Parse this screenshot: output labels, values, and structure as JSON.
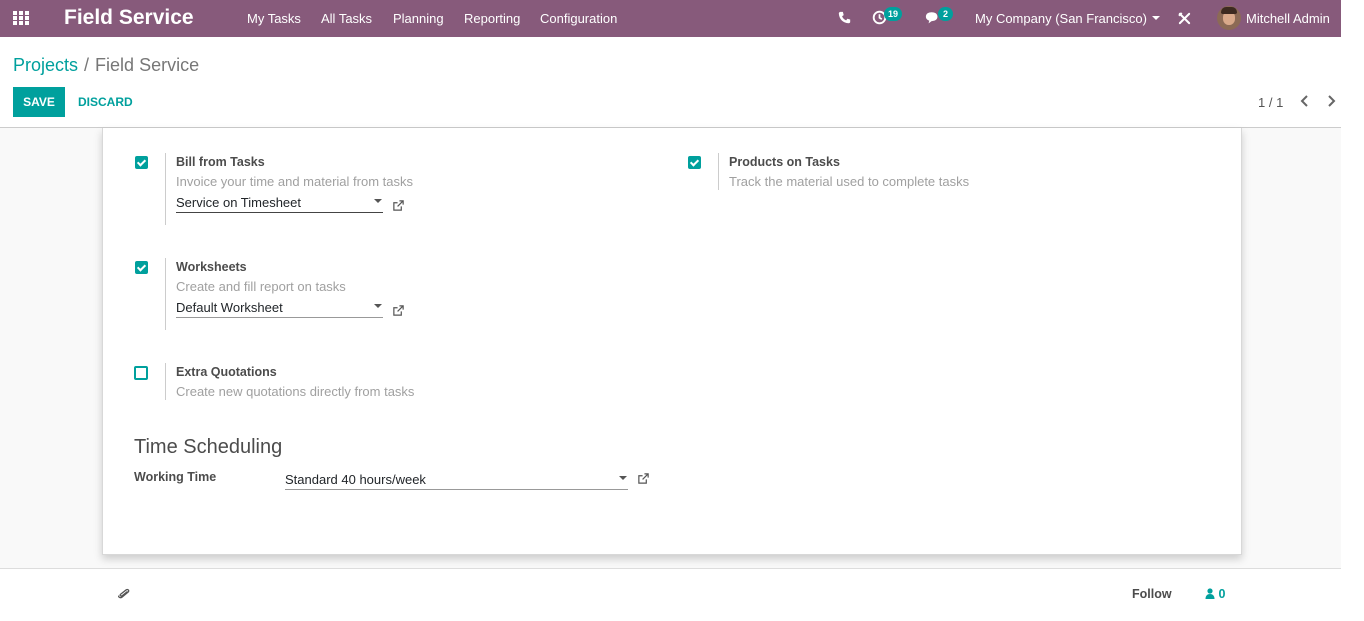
{
  "navbar": {
    "brand": "Field Service",
    "menus": [
      "My Tasks",
      "All Tasks",
      "Planning",
      "Reporting",
      "Configuration"
    ],
    "activity_count": "19",
    "message_count": "2",
    "company": "My Company (San Francisco)",
    "user": "Mitchell Admin",
    "icons": [
      "apps-grid-icon",
      "phone-icon",
      "activity-clock-icon",
      "chat-icon",
      "debug-tools-icon",
      "avatar"
    ]
  },
  "breadcrumb": {
    "parent": "Projects",
    "separator": "/",
    "current": "Field Service"
  },
  "actions": {
    "save": "SAVE",
    "discard": "DISCARD"
  },
  "pager": {
    "value": "1 / 1"
  },
  "settings": {
    "bill_from_tasks": {
      "checked": true,
      "title": "Bill from Tasks",
      "description": "Invoice your time and material from tasks",
      "selected": "Service on Timesheet"
    },
    "products_on_tasks": {
      "checked": true,
      "title": "Products on Tasks",
      "description": "Track the material used to complete tasks"
    },
    "worksheets": {
      "checked": true,
      "title": "Worksheets",
      "description": "Create and fill report on tasks",
      "selected": "Default Worksheet"
    },
    "extra_quotations": {
      "checked": false,
      "title": "Extra Quotations",
      "description": "Create new quotations directly from tasks"
    }
  },
  "time_scheduling": {
    "title": "Time Scheduling",
    "working_time_label": "Working Time",
    "working_time_value": "Standard 40 hours/week"
  },
  "chatter": {
    "follow": "Follow",
    "followers": "0"
  },
  "colors": {
    "navbar": "#875a7b",
    "accent": "#00a09d"
  }
}
